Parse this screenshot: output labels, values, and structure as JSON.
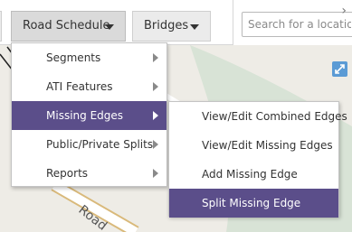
{
  "colors": {
    "accent": "#5b4e8a",
    "map_background": "#eeece6",
    "map_water": "#d8e3d6",
    "road_casing": "#d9b97a",
    "expand_button": "#5b9bd5"
  },
  "toolbar": {
    "tabs": [
      {
        "label": "Road Schedule",
        "icon": "caret-down-icon"
      },
      {
        "label": "Bridges",
        "icon": "caret-down-icon"
      }
    ]
  },
  "search": {
    "placeholder": "Search for a location",
    "collapse_icon": "chevron-right-icon"
  },
  "map": {
    "road_label": "Road",
    "expand_icon": "expand-arrows-icon"
  },
  "menu": {
    "items": [
      {
        "label": "Segments",
        "has_submenu": true
      },
      {
        "label": "ATI Features",
        "has_submenu": true
      },
      {
        "label": "Missing Edges",
        "has_submenu": true,
        "active": true
      },
      {
        "label": "Public/Private Splits",
        "has_submenu": true
      },
      {
        "label": "Reports",
        "has_submenu": true
      }
    ]
  },
  "submenu": {
    "items": [
      {
        "label": "View/Edit Combined Edges"
      },
      {
        "label": "View/Edit Missing Edges"
      },
      {
        "label": "Add Missing Edge"
      },
      {
        "label": "Split Missing Edge",
        "active": true
      }
    ]
  }
}
